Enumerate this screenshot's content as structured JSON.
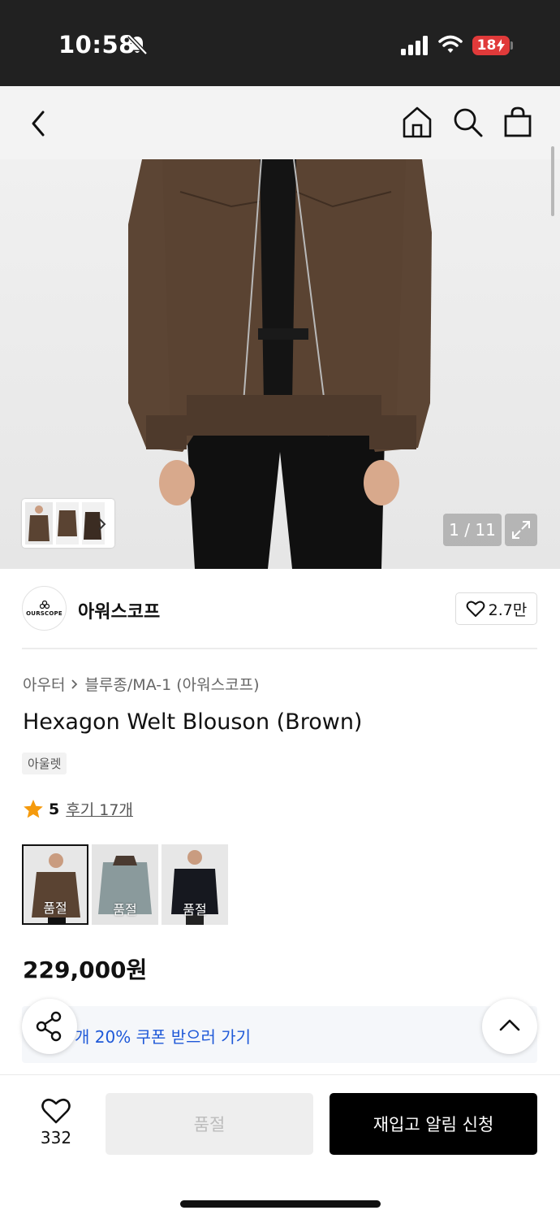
{
  "status_bar": {
    "time": "10:58",
    "battery": "18",
    "icons": [
      "bell-off-icon",
      "cellular-signal-icon",
      "wifi-icon",
      "battery-charging-icon"
    ]
  },
  "nav": {
    "icons": [
      "back-arrow-icon",
      "home-icon",
      "search-icon",
      "shopping-bag-icon"
    ]
  },
  "gallery": {
    "counter": "1 / 11",
    "icons": [
      "chevron-right-icon",
      "expand-icon"
    ]
  },
  "brand": {
    "name": "아워스코프",
    "logo_text": "OURSCOPE",
    "likes": "2.7만"
  },
  "product": {
    "breadcrumb": [
      "아우터",
      "블루종/MA-1 (아워스코프)"
    ],
    "title": "Hexagon Welt Blouson (Brown)",
    "tag": "아울렛",
    "rating": "5",
    "reviews": "후기 17개",
    "price": "229,000원"
  },
  "variants": [
    {
      "label": "품절",
      "color": "brown"
    },
    {
      "label": "품절",
      "color": "grey"
    },
    {
      "label": "품절",
      "color": "black"
    }
  ],
  "coupon": {
    "text": "개 20% 쿠폰 받으러 가기"
  },
  "bottom_bar": {
    "like_count": "332",
    "soldout_label": "품절",
    "restock_label": "재입고 알림 신청"
  },
  "colors": {
    "accent_blue": "#1f59d8",
    "star": "#f59a0c",
    "battery": "#e03a3a",
    "jacket_brown": "#5a4332"
  }
}
